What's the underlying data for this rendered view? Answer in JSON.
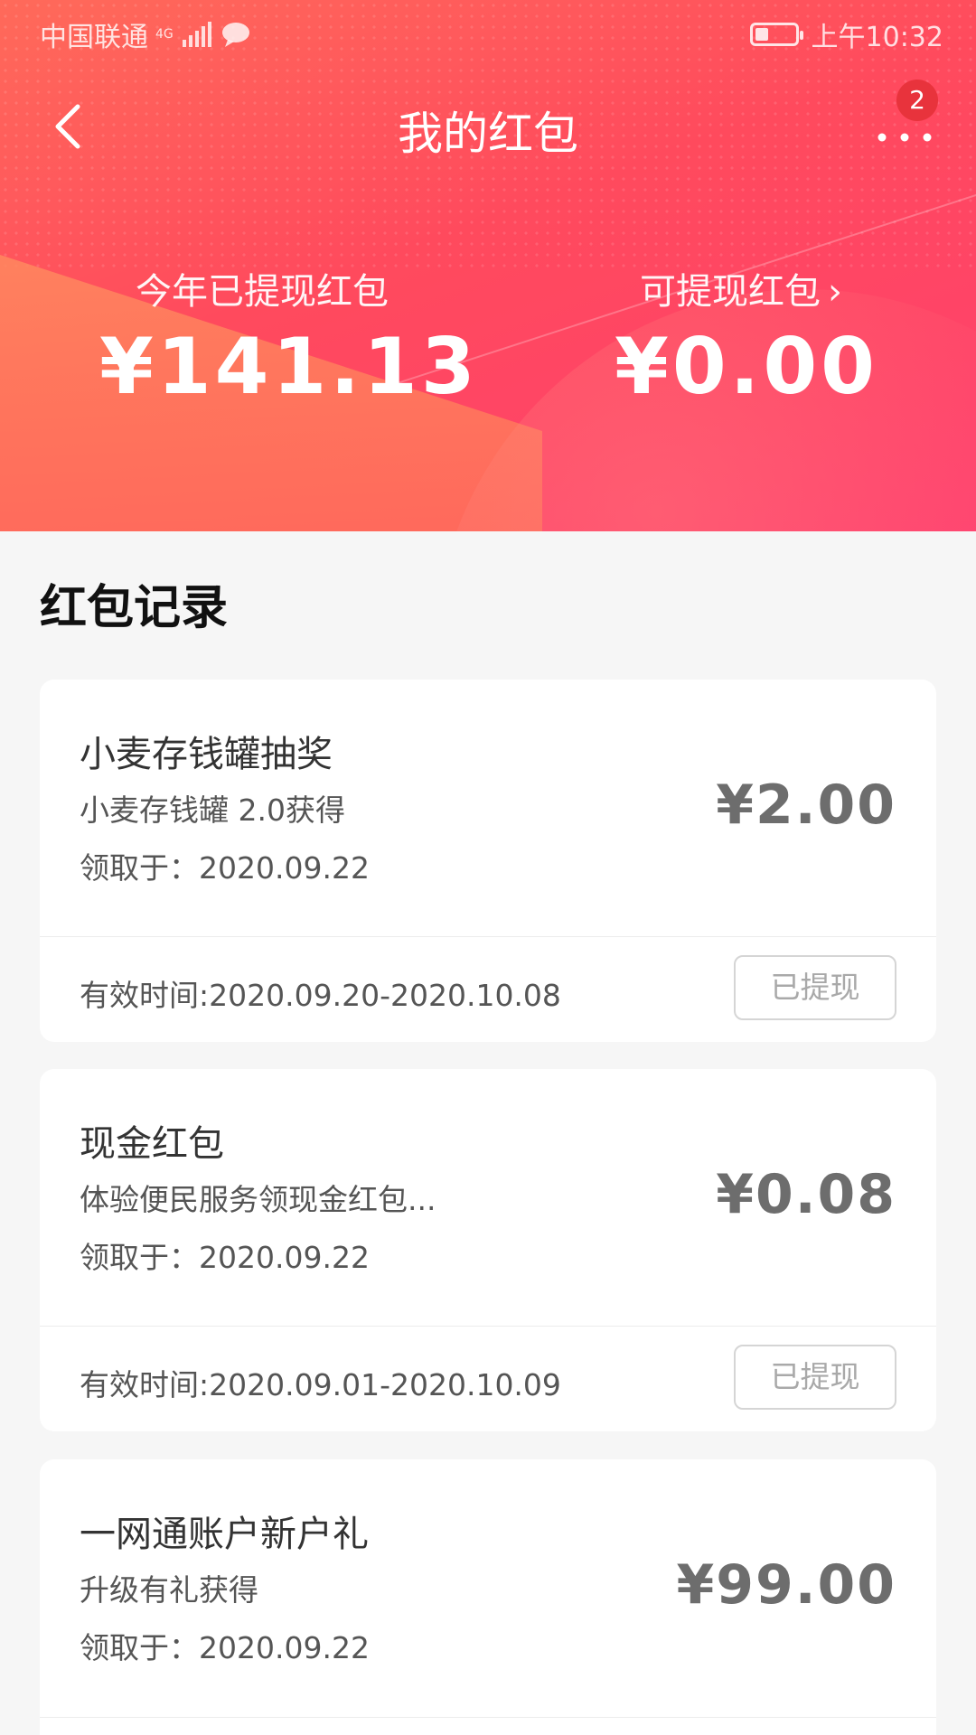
{
  "status_bar": {
    "carrier": "中国联通",
    "network": "4G",
    "time": "上午10:32"
  },
  "nav": {
    "title": "我的红包",
    "more_badge": "2"
  },
  "summary": {
    "withdrawn_label": "今年已提现红包",
    "withdrawn_amount": "¥141.13",
    "available_label": "可提现红包",
    "available_amount": "¥0.00"
  },
  "records": {
    "title": "红包记录",
    "items": [
      {
        "name": "小麦存钱罐抽奖",
        "desc": "小麦存钱罐 2.0获得",
        "received": "领取于：2020.09.22",
        "amount": "¥2.00",
        "valid": "有效时间:2020.09.20-2020.10.08",
        "button": "已提现"
      },
      {
        "name": "现金红包",
        "desc": "体验便民服务领现金红包...",
        "received": "领取于：2020.09.22",
        "amount": "¥0.08",
        "valid": "有效时间:2020.09.01-2020.10.09",
        "button": "已提现"
      },
      {
        "name": "一网通账户新户礼",
        "desc": "升级有礼获得",
        "received": "领取于：2020.09.22",
        "amount": "¥99.00"
      }
    ]
  },
  "colors": {
    "header_start": "#ff6a5a",
    "header_end": "#ff3f6f",
    "badge": "#e8333c"
  }
}
